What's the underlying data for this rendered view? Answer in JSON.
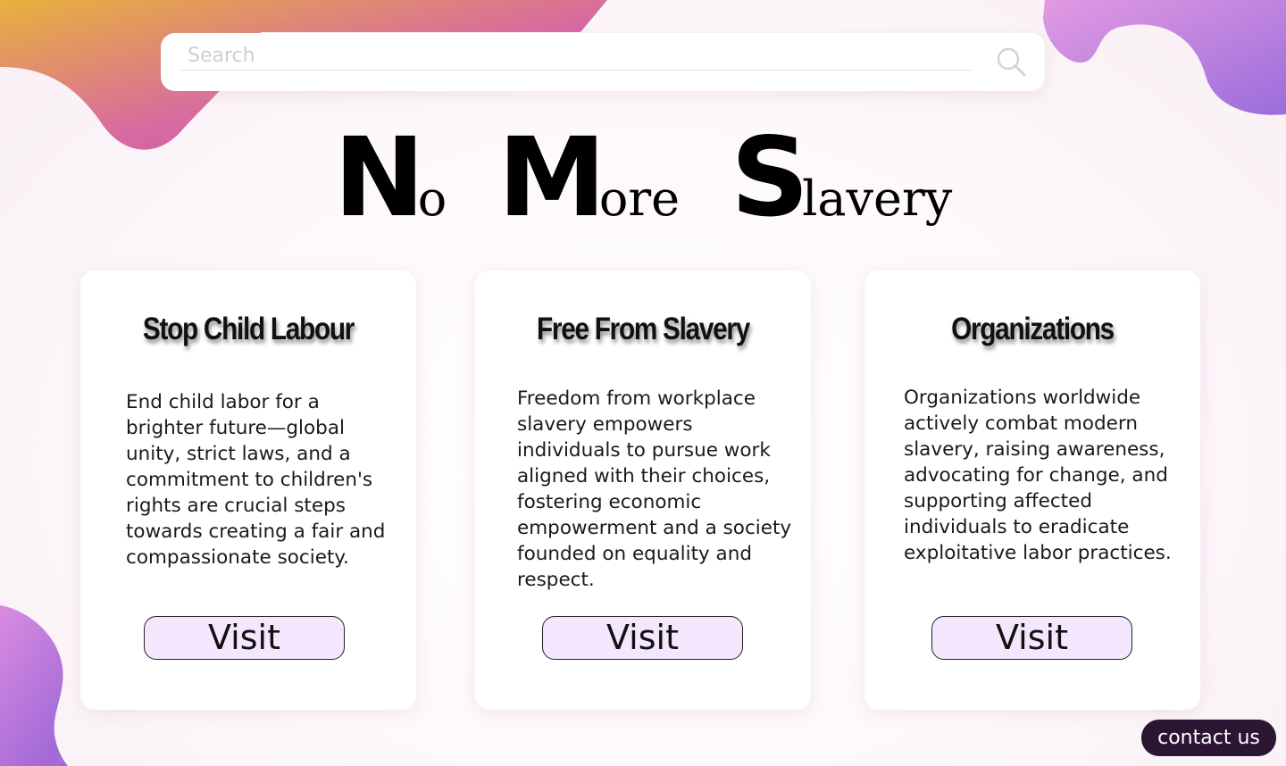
{
  "search": {
    "placeholder": "Search"
  },
  "title": {
    "words": [
      {
        "cap": "N",
        "rest": "o"
      },
      {
        "cap": "M",
        "rest": "ore"
      },
      {
        "cap": "S",
        "rest": "lavery"
      }
    ]
  },
  "cards": [
    {
      "heading": "Stop Child Labour",
      "body": "End child labor for a brighter future—global unity, strict laws, and a commitment to children's rights are crucial steps towards creating a fair and compassionate society.",
      "button": "Visit"
    },
    {
      "heading": "Free From Slavery",
      "body": "Freedom from workplace slavery empowers individuals to pursue work aligned with their choices, fostering economic empowerment and a society founded on equality and respect.",
      "button": "Visit"
    },
    {
      "heading": "Organizations",
      "body": "Organizations worldwide actively combat modern slavery, raising awareness, advocating for change, and supporting affected individuals to eradicate exploitative labor practices.",
      "button": "Visit"
    }
  ],
  "contact": {
    "label": "contact us"
  },
  "colors": {
    "blob_orange": "#e8b13c",
    "blob_pink": "#cf56aa",
    "blob_purple": "#9e6edc",
    "button_fill": "#f4e6fc",
    "contact_fill": "#2a1533"
  },
  "icons": [
    "search-icon"
  ]
}
